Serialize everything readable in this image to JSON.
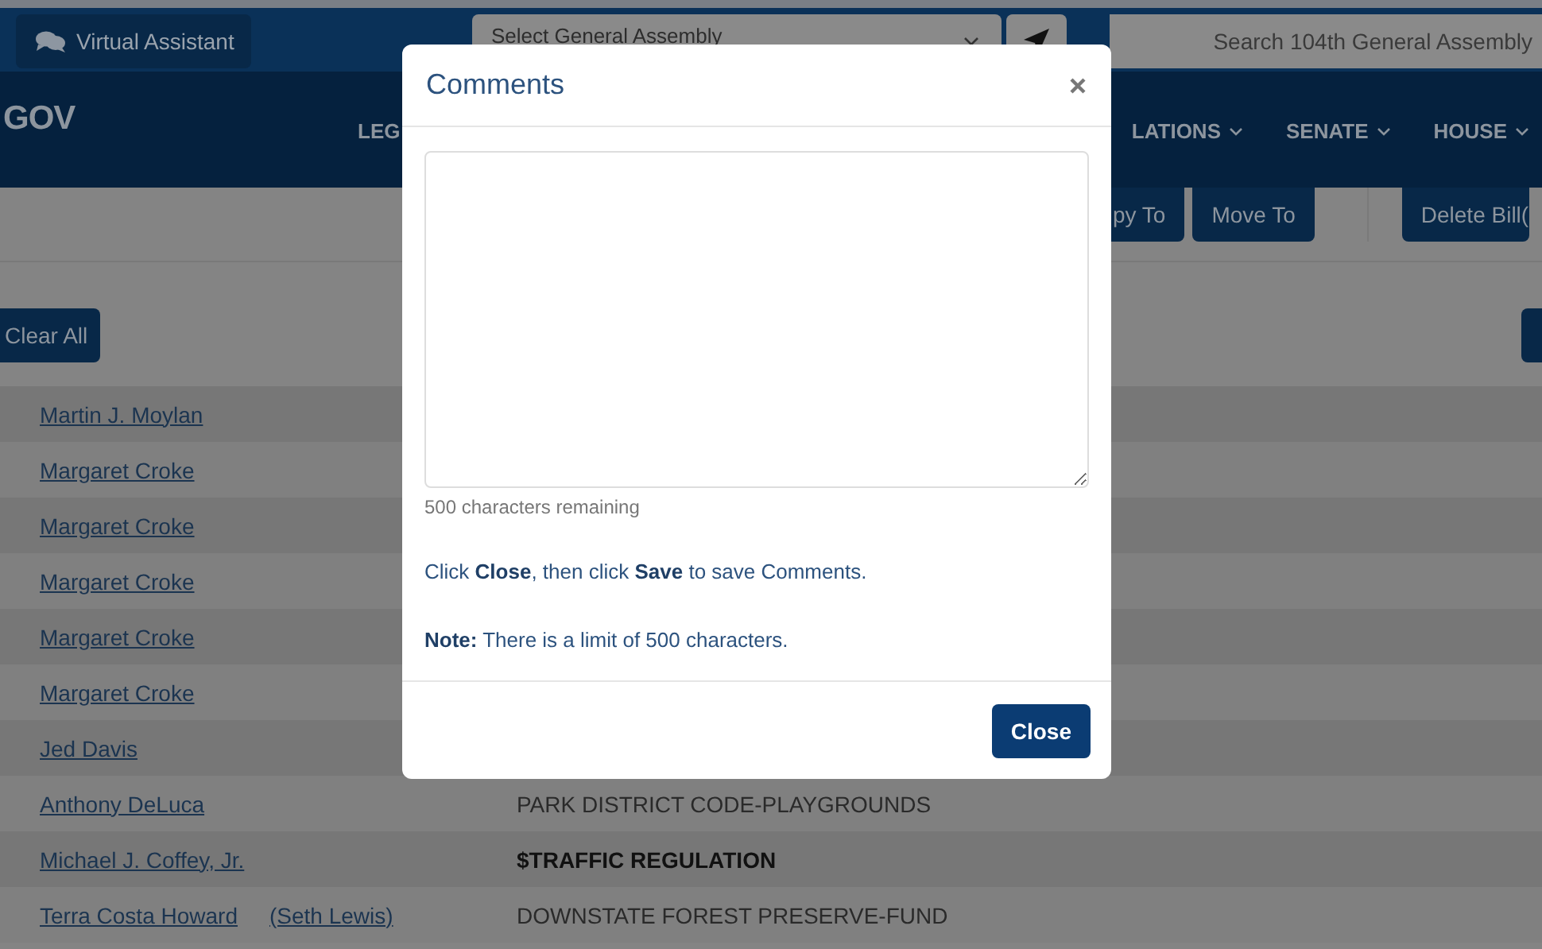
{
  "top_bar": {
    "assistant_button": "Virtual Assistant",
    "assembly_select": "Select General Assembly",
    "search": {
      "placeholder": "Search 104th General Assembly"
    }
  },
  "nav": {
    "logo": "GOV",
    "items": [
      {
        "label": "LEG",
        "dropdown": false
      },
      {
        "label": "LATIONS",
        "dropdown": true
      },
      {
        "label": "SENATE",
        "dropdown": true
      },
      {
        "label": "HOUSE",
        "dropdown": true
      }
    ]
  },
  "toolbar": {
    "buttons": [
      "py To",
      "Move To",
      "Delete Bill("
    ]
  },
  "clear_button": "Clear All",
  "rows": [
    {
      "sponsor": "Martin J. Moylan"
    },
    {
      "sponsor": "Margaret Croke"
    },
    {
      "sponsor": "Margaret Croke"
    },
    {
      "sponsor": "Margaret Croke"
    },
    {
      "sponsor": "Margaret Croke"
    },
    {
      "sponsor": "Margaret Croke"
    },
    {
      "sponsor": "Jed Davis"
    },
    {
      "sponsor": "Anthony DeLuca",
      "title": "PARK DISTRICT CODE-PLAYGROUNDS",
      "bold": false
    },
    {
      "sponsor": "Michael J. Coffey, Jr.",
      "title": "$TRAFFIC REGULATION",
      "bold": true
    },
    {
      "sponsor": "Terra Costa Howard",
      "cosponsor": "(Seth Lewis)",
      "title": "DOWNSTATE FOREST PRESERVE-FUND",
      "bold": false
    }
  ],
  "modal": {
    "title": "Comments",
    "counter": "500 characters remaining",
    "instruction": "Click **Close**, then click **Save** to save Comments.",
    "note": "**Note:** There is a limit of 500 characters.",
    "close_button": "Close"
  }
}
